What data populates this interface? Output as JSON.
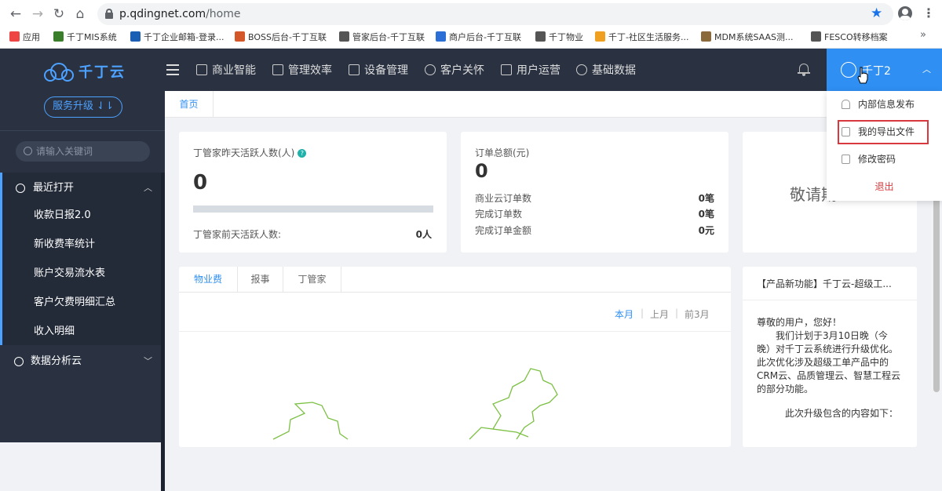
{
  "browser": {
    "url_domain": "p.qdingnet.com",
    "url_path": "/home",
    "bookmarks": [
      {
        "label": "应用",
        "color": "#e44"
      },
      {
        "label": "千丁MIS系统",
        "color": "#3a7d2a"
      },
      {
        "label": "千丁企业邮箱-登录...",
        "color": "#1a5fb4"
      },
      {
        "label": "BOSS后台-千丁互联",
        "color": "#d4572a"
      },
      {
        "label": "管家后台-千丁互联",
        "color": "#555"
      },
      {
        "label": "商户后台-千丁互联",
        "color": "#2b6fd6"
      },
      {
        "label": "千丁物业",
        "color": "#555"
      },
      {
        "label": "千丁-社区生活服务...",
        "color": "#f0a020"
      },
      {
        "label": "MDM系统SAAS测...",
        "color": "#8a6a3a"
      },
      {
        "label": "FESCO转移档案",
        "color": "#555"
      }
    ]
  },
  "sidebar": {
    "logo_text": "千丁云",
    "upgrade_label": "服务升级 ⇃⇂",
    "search_placeholder": "请输入关键词",
    "group_recent": "最近打开",
    "recent_items": [
      "收款日报2.0",
      "新收费率统计",
      "账户交易流水表",
      "客户欠费明细汇总",
      "收入明细"
    ],
    "group_analysis": "数据分析云"
  },
  "topnav": {
    "items": [
      "商业智能",
      "管理效率",
      "设备管理",
      "客户关怀",
      "用户运营",
      "基础数据"
    ],
    "user_name": "千丁2"
  },
  "tabs": {
    "home": "首页"
  },
  "card1": {
    "title": "丁管家昨天活跃人数(人)",
    "value": "0",
    "progress": 0.0,
    "footer_label": "丁管家前天活跃人数:",
    "footer_value": "0人"
  },
  "card2": {
    "title": "订单总额(元)",
    "value": "0",
    "rows": [
      {
        "label": "商业云订单数",
        "value": "0笔"
      },
      {
        "label": "完成订单数",
        "value": "0笔"
      },
      {
        "label": "完成订单金额",
        "value": "0元"
      }
    ]
  },
  "card3": {
    "greeting": "敬请期"
  },
  "panel": {
    "tabs": [
      "物业费",
      "报事",
      "丁管家"
    ],
    "filters": [
      "本月",
      "上月",
      "前3月"
    ]
  },
  "news": {
    "title": "【产品新功能】千丁云-超级工...",
    "body_lines": [
      "尊敬的用户，您好！",
      "　　我们计划于3月10日晚（今晚）对千丁云系统进行升级优化。此次优化涉及超级工单产品中的CRM云、品质管理云、智慧工程云的部分功能。",
      "　　　此次升级包含的内容如下："
    ]
  },
  "dropdown": {
    "items": [
      "内部信息发布",
      "我的导出文件",
      "修改密码"
    ],
    "logout": "退出"
  }
}
